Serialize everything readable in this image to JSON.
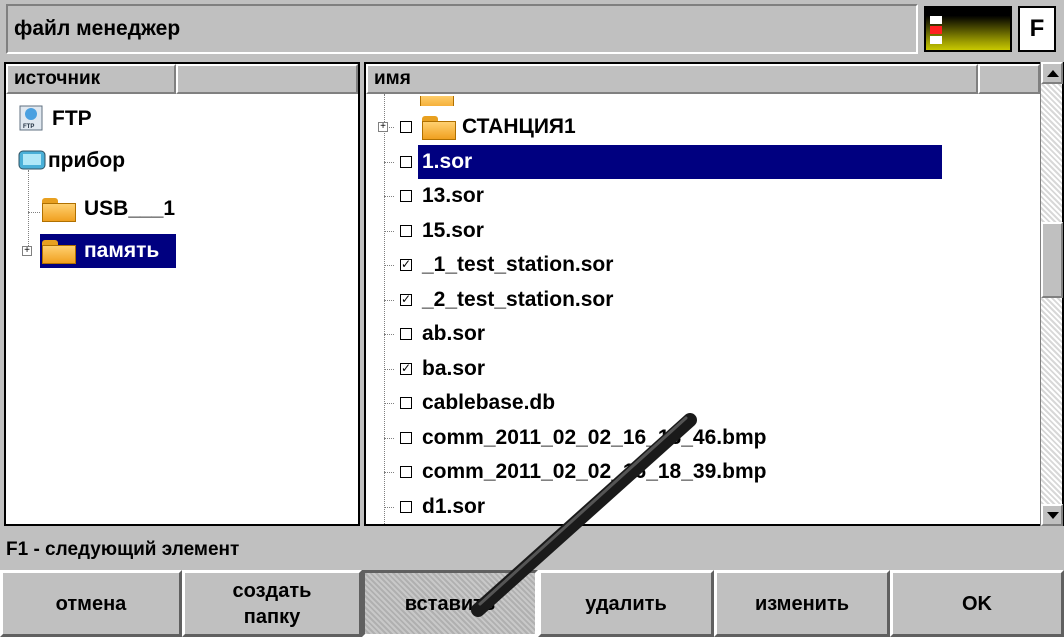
{
  "window": {
    "title": "файл менеджер",
    "indicator": "F"
  },
  "left_panel": {
    "columns": [
      "источник",
      ""
    ],
    "items": [
      {
        "label": "FTP",
        "icon": "ftp-icon"
      },
      {
        "label": "прибор",
        "icon": "device-icon"
      },
      {
        "label": "USB___1",
        "icon": "folder-icon"
      },
      {
        "label": "память",
        "icon": "folder-icon",
        "selected": true
      }
    ]
  },
  "right_panel": {
    "columns": [
      "имя",
      ""
    ],
    "items": [
      {
        "label": "СТАНЦИЯ1",
        "type": "folder",
        "checked": false
      },
      {
        "label": "1.sor",
        "type": "file",
        "checked": false,
        "selected": true
      },
      {
        "label": "13.sor",
        "type": "file",
        "checked": false
      },
      {
        "label": "15.sor",
        "type": "file",
        "checked": false
      },
      {
        "label": "_1_test_station.sor",
        "type": "file",
        "checked": true
      },
      {
        "label": "_2_test_station.sor",
        "type": "file",
        "checked": true
      },
      {
        "label": "ab.sor",
        "type": "file",
        "checked": false
      },
      {
        "label": "ba.sor",
        "type": "file",
        "checked": true
      },
      {
        "label": "cablebase.db",
        "type": "file",
        "checked": false
      },
      {
        "label": "comm_2011_02_02_16_18_46.bmp",
        "type": "file",
        "checked": false
      },
      {
        "label": "comm_2011_02_02_16_18_39.bmp",
        "type": "file",
        "checked": false
      },
      {
        "label": "d1.sor",
        "type": "file",
        "checked": false
      }
    ]
  },
  "status": "F1 - следующий элемент",
  "buttons": {
    "cancel": "отмена",
    "create_folder_1": "создать",
    "create_folder_2": "папку",
    "paste": "вставить",
    "delete": "удалить",
    "rename": "изменить",
    "ok": "OK"
  },
  "colors": {
    "selection": "#000080",
    "background": "#c0c0c0"
  }
}
